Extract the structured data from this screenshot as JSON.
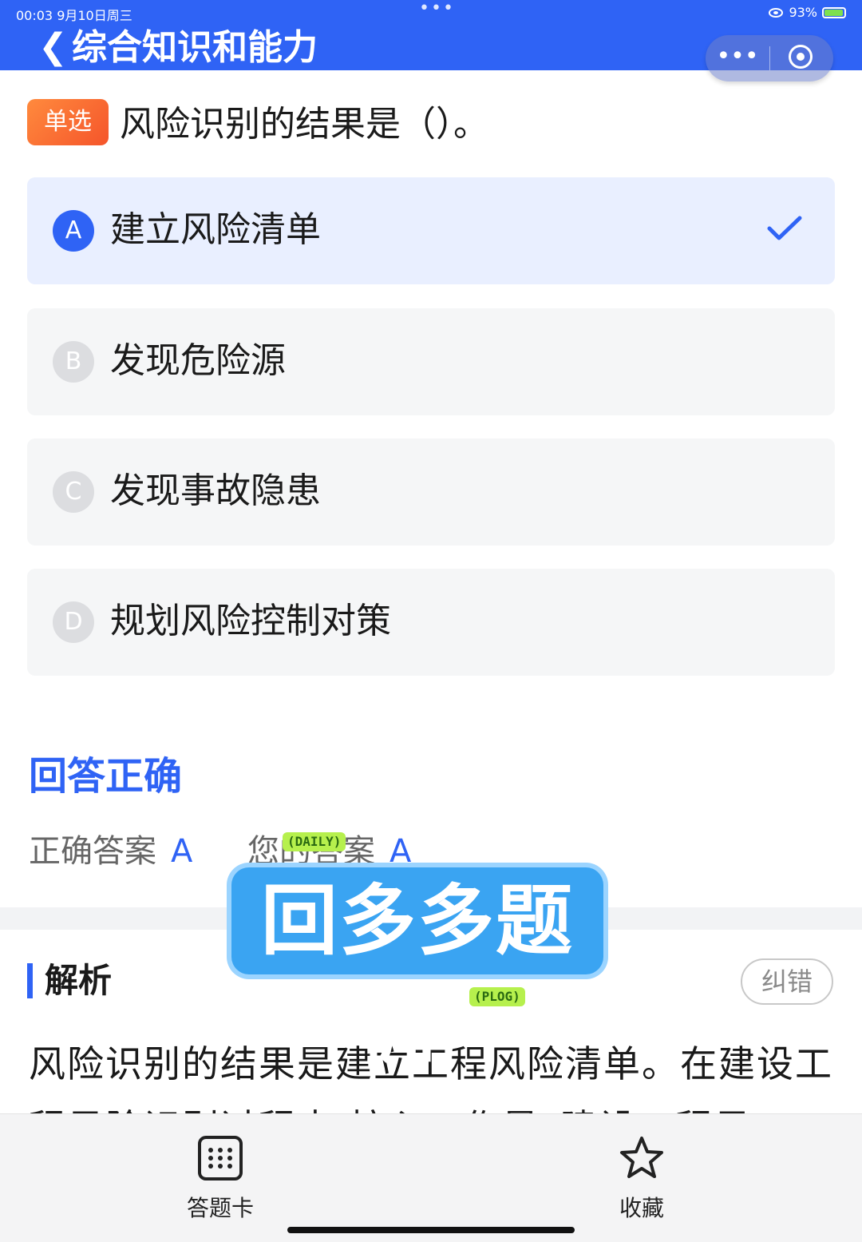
{
  "status_bar": {
    "time_date": "00:03  9月10日周三",
    "battery": "93%",
    "dots": "•••"
  },
  "header": {
    "back_icon": "back-arrow-icon",
    "title": "综合知识和能力",
    "more_icon": "more-dots-icon",
    "close_icon": "target-close-icon"
  },
  "question": {
    "type_label": "单选",
    "text": "风险识别的结果是（）。",
    "options": [
      {
        "letter": "A",
        "text": "建立风险清单",
        "selected": true
      },
      {
        "letter": "B",
        "text": "发现危险源",
        "selected": false
      },
      {
        "letter": "C",
        "text": "发现事故隐患",
        "selected": false
      },
      {
        "letter": "D",
        "text": "规划风险控制对策",
        "selected": false
      }
    ]
  },
  "result": {
    "title": "回答正确",
    "correct_label": "正确答案",
    "correct_value": "A",
    "yours_label": "您的答案",
    "yours_value": "A"
  },
  "analysis": {
    "title": "解析",
    "report_label": "纠错",
    "text": "风险识别的结果是建立工程风险清单。在建设工程风险识别过程中,核心工作是“建设工程风"
  },
  "watermark": {
    "text": "回多多题库",
    "tag_top": "(DAILY)",
    "tag_bottom": "(PLOG)"
  },
  "bottom_bar": {
    "tabs": [
      {
        "label": "答题卡",
        "icon": "answer-card-icon"
      },
      {
        "label": "收藏",
        "icon": "star-icon"
      }
    ]
  },
  "colors": {
    "accent": "#2f63f5",
    "badge": "#f5552b",
    "option_bg": "#f5f6f7",
    "selected_bg": "#e9efff"
  }
}
